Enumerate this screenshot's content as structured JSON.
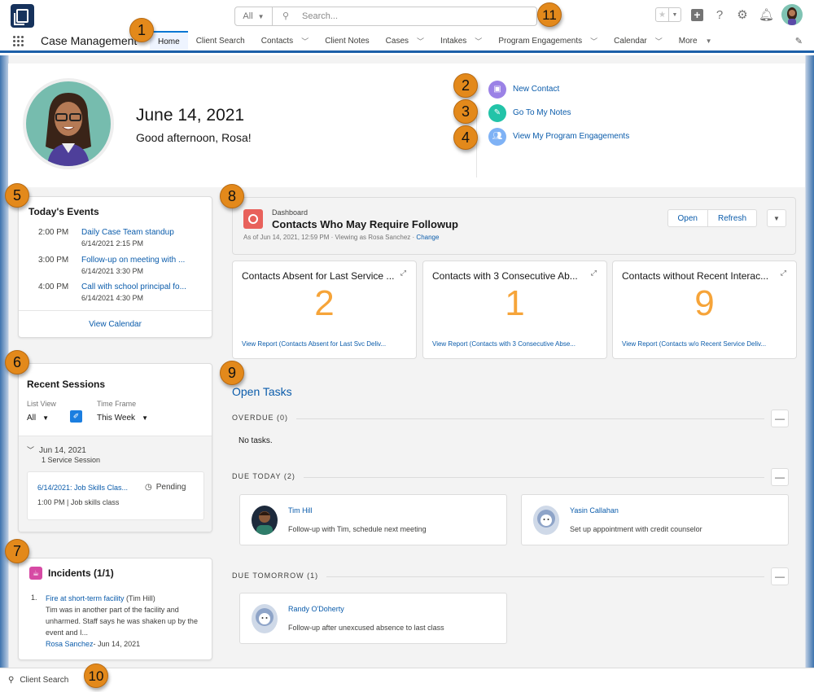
{
  "header": {
    "search_scope": "All",
    "search_placeholder": "Search...",
    "icons": [
      "favorites-star-icon",
      "global-actions-plus-icon",
      "help-icon",
      "setup-gear-icon",
      "notifications-bell-icon",
      "user-avatar"
    ]
  },
  "nav": {
    "app_name": "Case Management",
    "items": [
      {
        "label": "Home",
        "active": true,
        "has_dropdown": false
      },
      {
        "label": "Client Search",
        "has_dropdown": false
      },
      {
        "label": "Contacts",
        "has_dropdown": true
      },
      {
        "label": "Client Notes",
        "has_dropdown": false
      },
      {
        "label": "Cases",
        "has_dropdown": true
      },
      {
        "label": "Intakes",
        "has_dropdown": true
      },
      {
        "label": "Program Engagements",
        "has_dropdown": true
      },
      {
        "label": "Calendar",
        "has_dropdown": true
      },
      {
        "label": "More",
        "has_dropdown": true
      }
    ]
  },
  "banner": {
    "date": "June 14, 2021",
    "greeting": "Good afternoon, Rosa!",
    "quick_links": [
      {
        "label": "New Contact",
        "icon": "contact-card-icon",
        "color": "#9b82e6"
      },
      {
        "label": "Go To My Notes",
        "icon": "pencil-icon",
        "color": "#22c3a8"
      },
      {
        "label": "View My Program Engagements",
        "icon": "people-icon",
        "color": "#7fb2f5"
      }
    ]
  },
  "events": {
    "title": "Today's Events",
    "items": [
      {
        "time": "2:00 PM",
        "name": "Daily Case Team standup",
        "end": "6/14/2021 2:15 PM"
      },
      {
        "time": "3:00 PM",
        "name": "Follow-up on meeting with ...",
        "end": "6/14/2021 3:30 PM"
      },
      {
        "time": "4:00 PM",
        "name": "Call with school principal fo...",
        "end": "6/14/2021 4:30 PM"
      }
    ],
    "footer_link": "View Calendar"
  },
  "sessions": {
    "title": "Recent Sessions",
    "list_view_label": "List View",
    "list_view_value": "All",
    "time_frame_label": "Time Frame",
    "time_frame_value": "This Week",
    "group_date": "Jun 14, 2021",
    "group_count": "1 Service Session",
    "item": {
      "link": "6/14/2021: Job Skills Clas...",
      "status": "Pending",
      "meta": "1:00 PM | Job skills class"
    }
  },
  "incidents": {
    "title": "Incidents (1/1)",
    "items": [
      {
        "num": "1.",
        "link": "Fire at short-term facility",
        "person": "(Tim Hill)",
        "text": "Tim was in another part of the facility and unharmed. Staff says he was shaken up by the event and I...",
        "author": "Rosa Sanchez",
        "date": "- Jun 14, 2021"
      }
    ]
  },
  "dashboard": {
    "kicker": "Dashboard",
    "title": "Contacts Who May Require Followup",
    "meta": "As of Jun 14, 2021, 12:59 PM · Viewing as Rosa Sanchez · ",
    "change_link": "Change",
    "open_label": "Open",
    "refresh_label": "Refresh",
    "metric_color": "#f6a439",
    "metrics": [
      {
        "title": "Contacts Absent for Last Service ...",
        "value": "2",
        "link": "View Report (Contacts Absent for Last Svc Deliv..."
      },
      {
        "title": "Contacts with 3 Consecutive Ab...",
        "value": "1",
        "link": "View Report (Contacts with 3 Consecutive Abse..."
      },
      {
        "title": "Contacts without Recent Interac...",
        "value": "9",
        "link": "View Report (Contacts w/o Recent Service Deliv..."
      }
    ]
  },
  "tasks": {
    "title": "Open Tasks",
    "overdue_label": "OVERDUE (0)",
    "no_tasks": "No tasks.",
    "due_today_label": "DUE TODAY (2)",
    "due_tomorrow_label": "DUE TOMORROW (1)",
    "due_today": [
      {
        "name": "Tim Hill",
        "desc": "Follow-up with Tim, schedule next meeting"
      },
      {
        "name": "Yasin Callahan",
        "desc": "Set up appointment with credit counselor"
      }
    ],
    "due_tomorrow": [
      {
        "name": "Randy O'Doherty",
        "desc": "Follow-up after unexcused absence to last class"
      }
    ]
  },
  "utility_bar": {
    "label": "Client Search"
  },
  "callouts": [
    "1",
    "2",
    "3",
    "4",
    "5",
    "6",
    "7",
    "8",
    "9",
    "10",
    "11"
  ]
}
